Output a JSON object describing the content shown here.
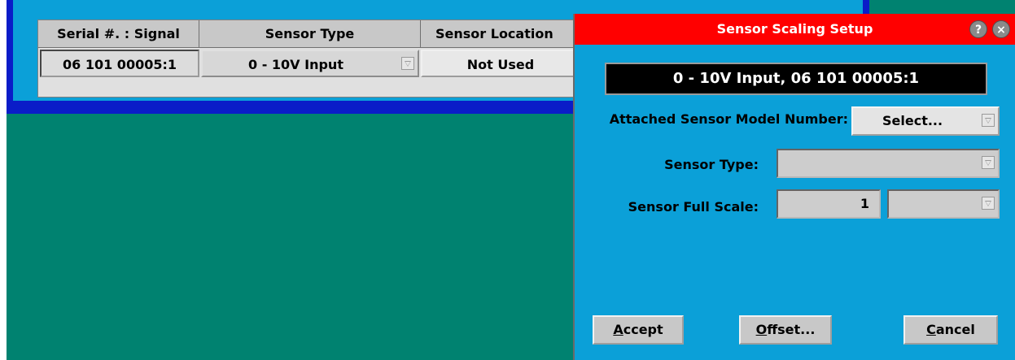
{
  "table": {
    "headers": [
      "Serial #. : Signal",
      "Sensor Type",
      "Sensor Location"
    ],
    "row": {
      "serial": "06 101 00005:1",
      "sensor_type": "0 - 10V Input",
      "sensor_location": "Not Used"
    }
  },
  "dialog": {
    "title": "Sensor Scaling Setup",
    "help_icon": "?",
    "close_icon": "×",
    "banner": "0 - 10V Input, 06 101 00005:1",
    "model_label": "Attached Sensor Model Number:",
    "model_value": "Select...",
    "type_label": "Sensor Type:",
    "type_value": "",
    "full_scale_label": "Sensor Full Scale:",
    "full_scale_value": "1",
    "full_scale_unit": "",
    "buttons": {
      "accept_first": "A",
      "accept_rest": "ccept",
      "offset_first": "O",
      "offset_rest": "ffset...",
      "cancel_first": "C",
      "cancel_rest": "ancel"
    }
  },
  "colors": {
    "desktop": "#008270",
    "panel_border": "#0a1cc8",
    "panel_fill": "#0ba0d8",
    "titlebar": "#ff0000"
  }
}
